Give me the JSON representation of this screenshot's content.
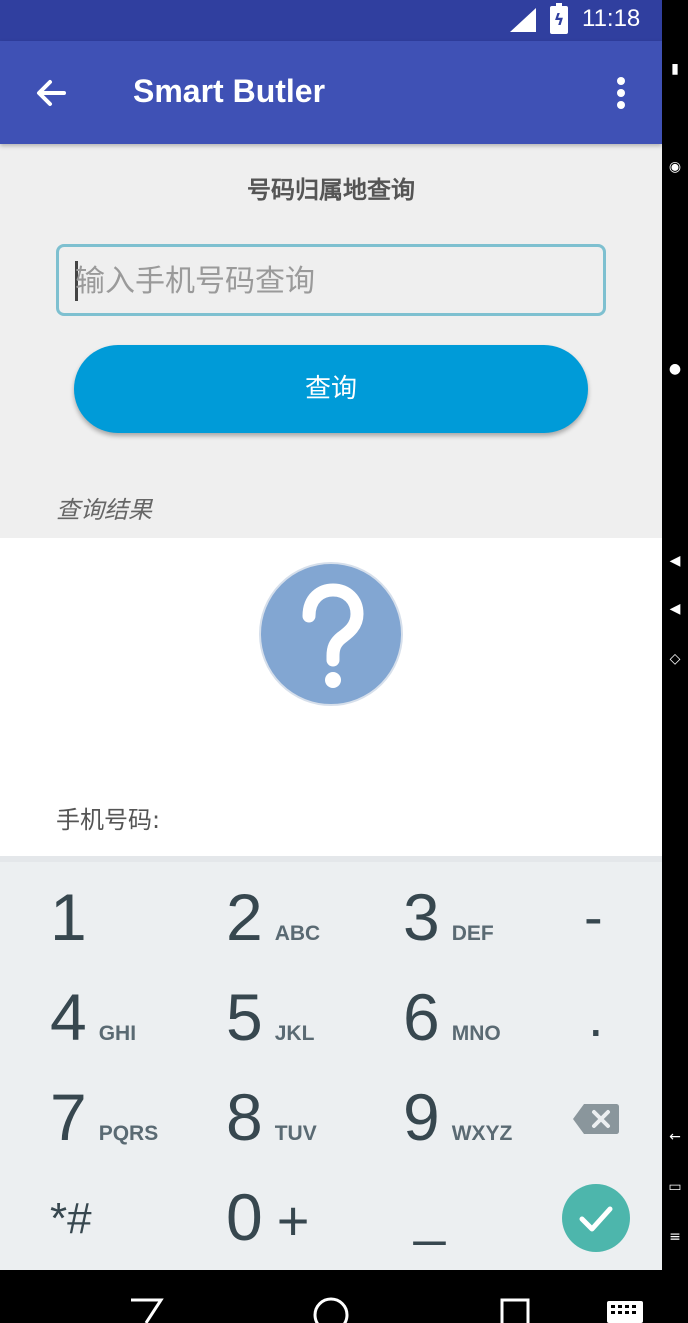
{
  "status_bar": {
    "time": "11:18"
  },
  "app_bar": {
    "title": "Smart Butler"
  },
  "content": {
    "section_title": "号码归属地查询",
    "input_placeholder": "输入手机号码查询",
    "query_button": "查询",
    "result_label": "查询结果",
    "phone_number_label": "手机号码:"
  },
  "keyboard": {
    "rows": [
      [
        {
          "digit": "1",
          "letters": ""
        },
        {
          "digit": "2",
          "letters": "ABC"
        },
        {
          "digit": "3",
          "letters": "DEF"
        },
        {
          "digit": "-",
          "letters": ""
        }
      ],
      [
        {
          "digit": "4",
          "letters": "GHI"
        },
        {
          "digit": "5",
          "letters": "JKL"
        },
        {
          "digit": "6",
          "letters": "MNO"
        },
        {
          "digit": ".",
          "letters": ""
        }
      ],
      [
        {
          "digit": "7",
          "letters": "PQRS"
        },
        {
          "digit": "8",
          "letters": "TUV"
        },
        {
          "digit": "9",
          "letters": "WXYZ"
        }
      ],
      [
        {
          "digit": "*#",
          "letters": ""
        },
        {
          "digit": "0",
          "letters": "+"
        },
        {
          "digit": "_",
          "letters": ""
        }
      ]
    ]
  },
  "colors": {
    "status_bar": "#303f9f",
    "app_bar": "#3f51b5",
    "query_button": "#009bd8",
    "question_icon": "#82a6d2",
    "done_key": "#4db6ac"
  },
  "icons": [
    "back-arrow-icon",
    "overflow-menu-icon",
    "question-mark-icon",
    "backspace-icon",
    "check-icon",
    "nav-back-icon",
    "nav-home-icon",
    "nav-recents-icon",
    "keyboard-icon"
  ]
}
